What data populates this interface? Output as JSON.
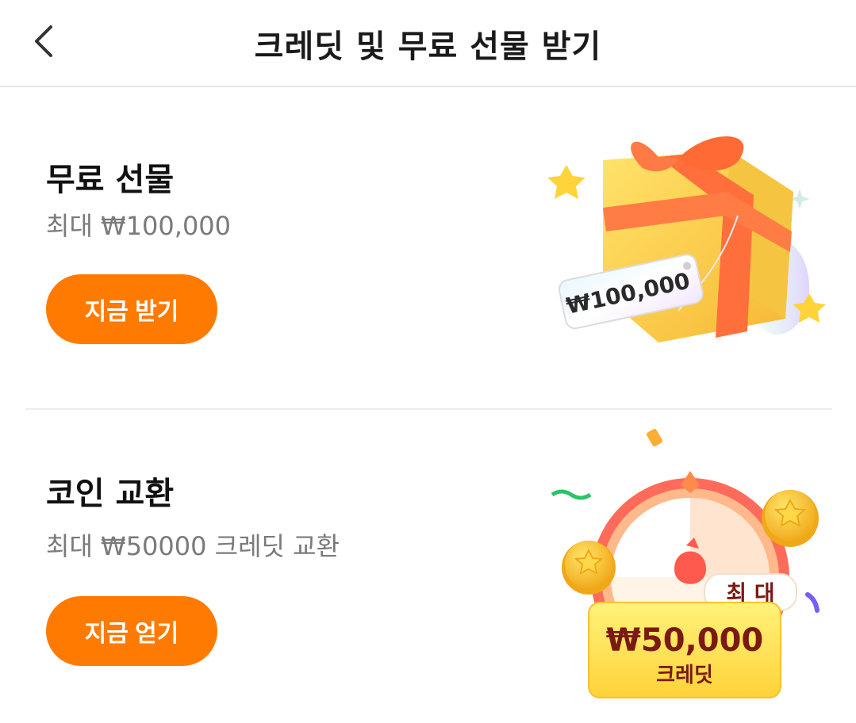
{
  "header": {
    "title": "크레딧 및 무료 선물 받기",
    "back_icon": "chevron-left-icon"
  },
  "cards": [
    {
      "title": "무료 선물",
      "subtitle": "최대 ₩100,000",
      "button_label": "지금 받기",
      "image": {
        "icon": "gift-box-icon",
        "tag_text": "₩100,000"
      }
    },
    {
      "title": "코인 교환",
      "subtitle": "최대 ₩50000 크레딧 교환",
      "button_label": "지금 얻기",
      "image": {
        "icon": "coin-wheel-icon",
        "badge_top": "최 대",
        "badge_amount": "₩50,000",
        "badge_unit": "크레딧"
      }
    }
  ],
  "colors": {
    "accent": "#ff7a00",
    "subtitle": "#7a7a7a",
    "badge_text": "#7a1a12"
  }
}
